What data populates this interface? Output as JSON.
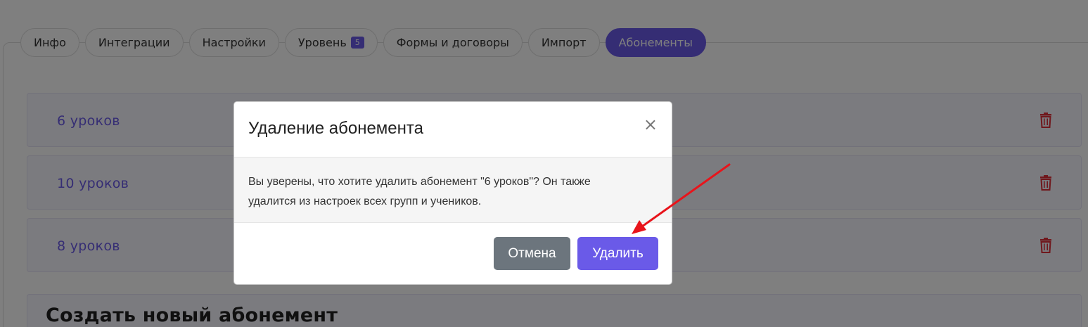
{
  "tabs": [
    {
      "label": "Инфо",
      "active": false
    },
    {
      "label": "Интеграции",
      "active": false
    },
    {
      "label": "Настройки",
      "active": false
    },
    {
      "label": "Уровень",
      "badge": "5",
      "active": false
    },
    {
      "label": "Формы и договоры",
      "active": false
    },
    {
      "label": "Импорт",
      "active": false
    },
    {
      "label": "Абонементы",
      "active": true
    }
  ],
  "subscriptions": [
    {
      "name": "6 уроков"
    },
    {
      "name": "10 уроков"
    },
    {
      "name": "8 уроков"
    }
  ],
  "create": {
    "title": "Создать новый абонемент"
  },
  "modal": {
    "title": "Удаление абонемента",
    "close": "×",
    "body_line1": "Вы уверены, что хотите удалить абонемент \"6 уроков\"? Он также",
    "body_line2": "удалится из настроек всех групп и учеников.",
    "cancel_label": "Отмена",
    "delete_label": "Удалить"
  },
  "colors": {
    "accent": "#6a5ae8",
    "danger": "#e0313b",
    "secondary": "#6c757d",
    "annotation_arrow": "#e8141b"
  },
  "icons": {
    "delete": "trash-icon",
    "close": "close-icon",
    "annotation": "arrow-annotation"
  }
}
